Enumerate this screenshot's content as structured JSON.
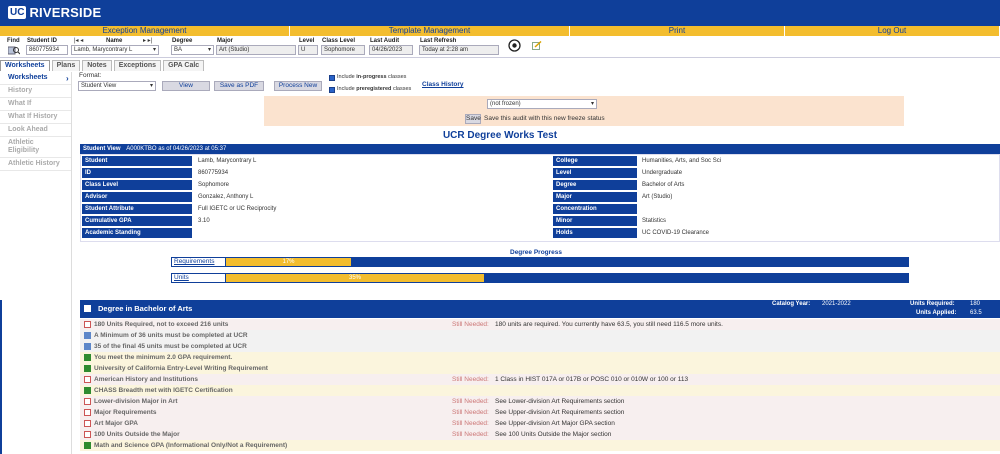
{
  "app": {
    "logo_uc": "UC",
    "logo_name": "RIVERSIDE"
  },
  "menu": [
    "Exception Management",
    "Template Management",
    "Print",
    "Log Out"
  ],
  "header": {
    "find_label": "Find",
    "student_id_label": "Student ID",
    "student_id": "860775934",
    "name_label": "Name",
    "name_value": "Lamb, Marycontrary L",
    "degree_label": "Degree",
    "degree_value": "BA",
    "major_label": "Major",
    "major_value": "Art (Studio)",
    "level_label": "Level",
    "level_value": "U",
    "class_level_label": "Class Level",
    "class_level_value": "Sophomore",
    "last_audit_label": "Last Audit",
    "last_audit_value": "04/26/2023",
    "last_refresh_label": "Last Refresh",
    "last_refresh_value": "Today at 2:28 am"
  },
  "tabs": [
    "Worksheets",
    "Plans",
    "Notes",
    "Exceptions",
    "GPA Calc"
  ],
  "sidebar": [
    "Worksheets",
    "History",
    "What If",
    "What If History",
    "Look Ahead",
    "Athletic Eligibility",
    "Athletic History"
  ],
  "format": {
    "label": "Format:",
    "value": "Student View",
    "view_btn": "View",
    "pdf_btn": "Save as PDF",
    "process_btn": "Process New",
    "inprog_prefix": "Include ",
    "inprog_bold": "in-progress",
    "inprog_suffix": " classes",
    "prereg_prefix": "Include ",
    "prereg_bold": "preregistered",
    "prereg_suffix": " classes",
    "class_history": "Class History"
  },
  "freeze": {
    "select": "(not frozen)",
    "save_btn": "Save",
    "text": "Save this audit with this new freeze status"
  },
  "title": "UCR Degree Works Test",
  "student_view": {
    "label": "Student View",
    "detail": "A000KTBO as of 04/26/2023 at 05:37"
  },
  "info_left": [
    {
      "label": "Student",
      "value": "Lamb, Marycontrary L"
    },
    {
      "label": "ID",
      "value": "860775934"
    },
    {
      "label": "Class Level",
      "value": "Sophomore"
    },
    {
      "label": "Advisor",
      "value": "Gonzalez, Anthony L"
    },
    {
      "label": "Student Attribute",
      "value": "Full IGETC or UC Reciprocity"
    },
    {
      "label": "Cumulative GPA",
      "value": "3.10"
    },
    {
      "label": "Academic Standing",
      "value": ""
    }
  ],
  "info_right": [
    {
      "label": "College",
      "value": "Humanities, Arts, and Soc Sci"
    },
    {
      "label": "Level",
      "value": "Undergraduate"
    },
    {
      "label": "Degree",
      "value": "Bachelor of Arts"
    },
    {
      "label": "Major",
      "value": "Art (Studio)"
    },
    {
      "label": "Concentration",
      "value": ""
    },
    {
      "label": "Minor",
      "value": "Statistics"
    },
    {
      "label": "Holds",
      "value": "UC COVID-19 Clearance"
    }
  ],
  "progress": {
    "title": "Degree Progress",
    "requirements_label": "Requirements",
    "requirements_pct": "17%",
    "requirements_value": 0.17,
    "units_label": "Units",
    "units_pct": "35%",
    "units_value": 0.35
  },
  "degree": {
    "title": "Degree in Bachelor of Arts",
    "catalog_label": "Catalog Year:",
    "catalog_value": "2021-2022",
    "units_req_label": "Units Required:",
    "units_req_value": "180",
    "units_app_label": "Units Applied:",
    "units_app_value": "63.5"
  },
  "requirements": [
    {
      "label": "180 Units Required, not to exceed 216 units",
      "status": "no",
      "needed": "Still Needed:",
      "note": "180 units are required. You currently have 63.5, you still need 116.5 more units."
    },
    {
      "label": "A Minimum of 36 units must be completed at UCR",
      "status": "mid",
      "needed": "",
      "note": ""
    },
    {
      "label": "35 of the final 45 units must be completed at UCR",
      "status": "mid",
      "needed": "",
      "note": ""
    },
    {
      "label": "You meet the minimum 2.0 GPA requirement.",
      "status": "ok",
      "needed": "",
      "note": ""
    },
    {
      "label": "University of California Entry-Level Writing Requirement",
      "status": "ok",
      "needed": "",
      "note": ""
    },
    {
      "label": "American History and Institutions",
      "status": "no",
      "needed": "Still Needed:",
      "note": "1 Class in HIST 017A or 017B or POSC 010 or 010W or 100 or 113"
    },
    {
      "label": "CHASS Breadth met with IGETC Certification",
      "status": "ok",
      "needed": "",
      "note": ""
    },
    {
      "label": "Lower-division Major in Art",
      "status": "no",
      "needed": "Still Needed:",
      "note": "See Lower-division Art Requirements section"
    },
    {
      "label": "Major Requirements",
      "status": "no",
      "needed": "Still Needed:",
      "note": "See Upper-division Art Requirements section"
    },
    {
      "label": "Art Major GPA",
      "status": "no",
      "needed": "Still Needed:",
      "note": "See Upper-division Art Major GPA section"
    },
    {
      "label": "100 Units Outside the Major",
      "status": "no",
      "needed": "Still Needed:",
      "note": "See 100 Units Outside the Major section"
    },
    {
      "label": "Math and Science GPA (Informational Only/Not a Requirement)",
      "status": "ok",
      "needed": "",
      "note": ""
    }
  ],
  "colors": {
    "brand": "#0f3f9a",
    "accent": "#f3bd2e",
    "freeze_bg": "#fbe3cf"
  }
}
